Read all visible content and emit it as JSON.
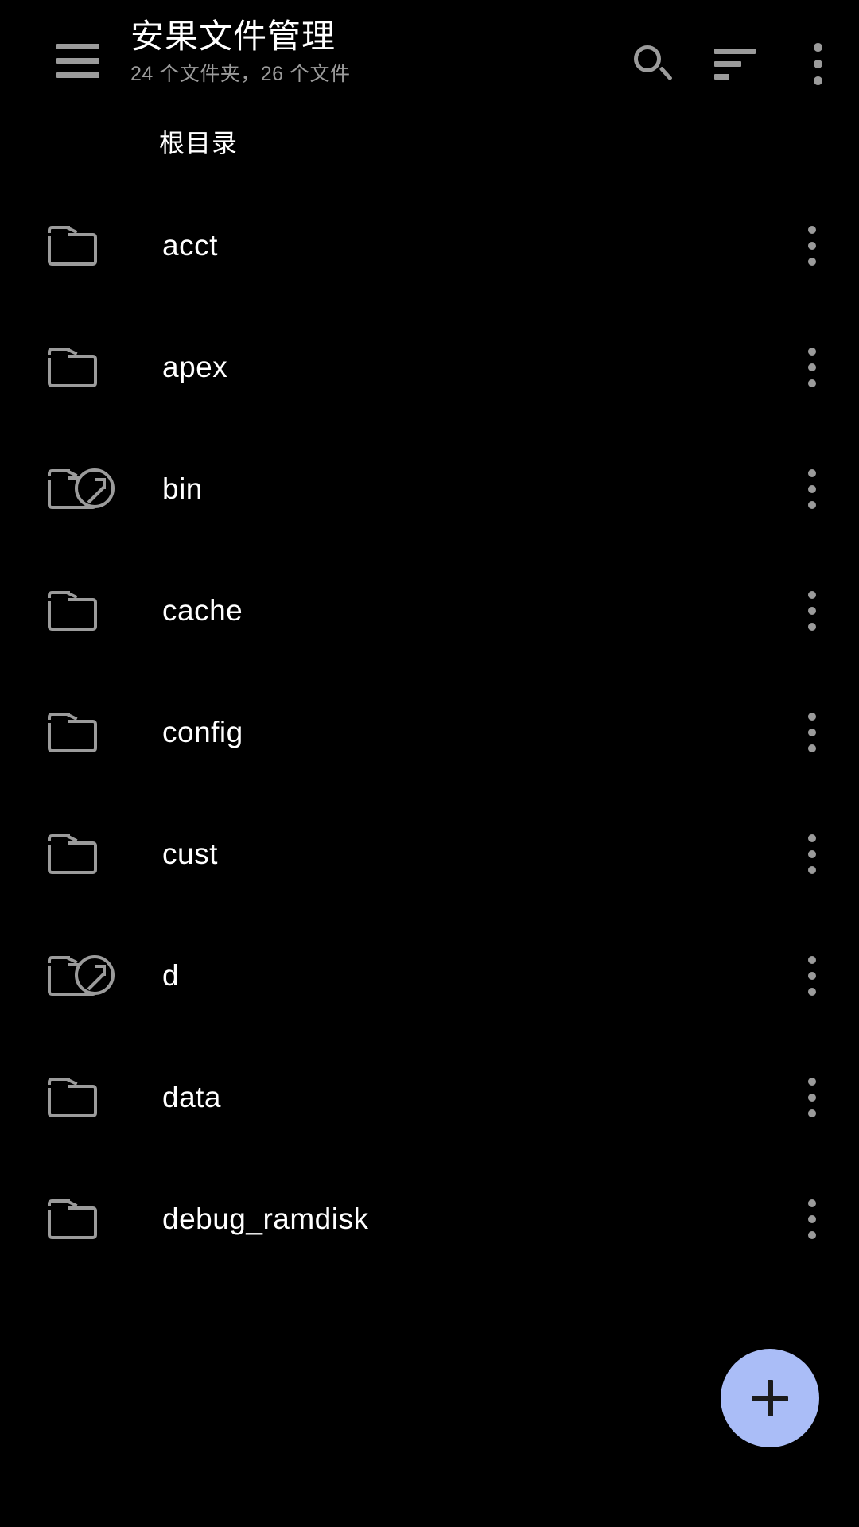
{
  "toolbar": {
    "menu_icon": "hamburger-menu-icon",
    "title": "安果文件管理",
    "subtitle": "24 个文件夹，26 个文件",
    "search_icon": "search-icon",
    "sort_icon": "sort-icon",
    "overflow_icon": "more-vertical-icon"
  },
  "breadcrumb": {
    "items": [
      {
        "label": "根目录"
      }
    ]
  },
  "list": {
    "row_more_icon": "more-vertical-icon",
    "items": [
      {
        "name": "acct",
        "icon": "folder-icon"
      },
      {
        "name": "apex",
        "icon": "folder-icon"
      },
      {
        "name": "bin",
        "icon": "folder-symlink-icon"
      },
      {
        "name": "cache",
        "icon": "folder-icon"
      },
      {
        "name": "config",
        "icon": "folder-icon"
      },
      {
        "name": "cust",
        "icon": "folder-icon"
      },
      {
        "name": "d",
        "icon": "folder-symlink-icon"
      },
      {
        "name": "data",
        "icon": "folder-icon"
      },
      {
        "name": "debug_ramdisk",
        "icon": "folder-icon"
      }
    ]
  },
  "fab": {
    "label": "+",
    "icon": "plus-icon",
    "color": "#aabdf7"
  },
  "theme": {
    "background": "#000000",
    "text_primary": "#ffffff",
    "text_secondary": "#9b9b9b",
    "icon": "#9b9b9b",
    "accent": "#aabdf7"
  }
}
